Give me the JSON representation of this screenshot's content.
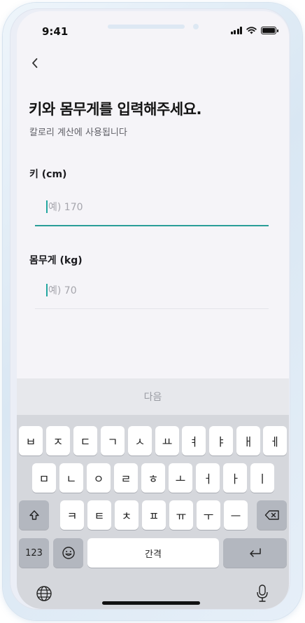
{
  "status": {
    "time": "9:41"
  },
  "nav": {
    "back_icon": "chevron-left-icon"
  },
  "header": {
    "title": "키와 몸무게를 입력해주세요.",
    "subtitle": "칼로리 계산에 사용됩니다"
  },
  "form": {
    "height": {
      "label": "키 (cm)",
      "placeholder": "예) 170"
    },
    "weight": {
      "label": "몸무게 (kg)",
      "placeholder": "예) 70"
    }
  },
  "keyboard": {
    "toolbar_next": "다음",
    "row1": [
      "ㅂ",
      "ㅈ",
      "ㄷ",
      "ㄱ",
      "ㅅ",
      "ㅛ",
      "ㅕ",
      "ㅑ",
      "ㅐ",
      "ㅔ"
    ],
    "row2": [
      "ㅁ",
      "ㄴ",
      "ㅇ",
      "ㄹ",
      "ㅎ",
      "ㅗ",
      "ㅓ",
      "ㅏ",
      "ㅣ"
    ],
    "row3": [
      "ㅋ",
      "ㅌ",
      "ㅊ",
      "ㅍ",
      "ㅠ",
      "ㅜ",
      "ㅡ"
    ],
    "numbers_key": "123",
    "space_key": "간격"
  },
  "colors": {
    "accent": "#2a9e98",
    "background": "#f5f4f8",
    "keyboard": "#d5d7dc"
  }
}
